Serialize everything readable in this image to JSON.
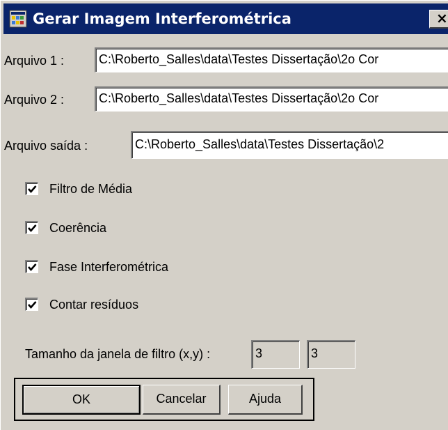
{
  "window": {
    "title": "Gerar Imagem Interferométrica",
    "close_glyph": "×"
  },
  "fields": {
    "arquivo1": {
      "label": "Arquivo 1 :",
      "value": "C:\\Roberto_Salles\\data\\Testes Dissertação\\2o Cor"
    },
    "arquivo2": {
      "label": "Arquivo 2 :",
      "value": "C:\\Roberto_Salles\\data\\Testes Dissertação\\2o Cor"
    },
    "arquivo_saida": {
      "label": "Arquivo saída :",
      "value": "C:\\Roberto_Salles\\data\\Testes Dissertação\\2"
    }
  },
  "options": [
    {
      "label": "Filtro de Média",
      "checked": true
    },
    {
      "label": "Coerência",
      "checked": true
    },
    {
      "label": "Fase Interferométrica",
      "checked": true
    },
    {
      "label": "Contar resíduos",
      "checked": true
    }
  ],
  "filter_window": {
    "label": "Tamanho da janela de filtro (x,y) :",
    "x": "3",
    "y": "3"
  },
  "buttons": {
    "ok": "OK",
    "cancel": "Cancelar",
    "help": "Ajuda"
  },
  "icons": {
    "app": "app-grid-icon",
    "close": "close-icon",
    "check": "checkmark-icon"
  },
  "colors": {
    "titlebar": "#0a246a",
    "face": "#d4d0c8"
  }
}
